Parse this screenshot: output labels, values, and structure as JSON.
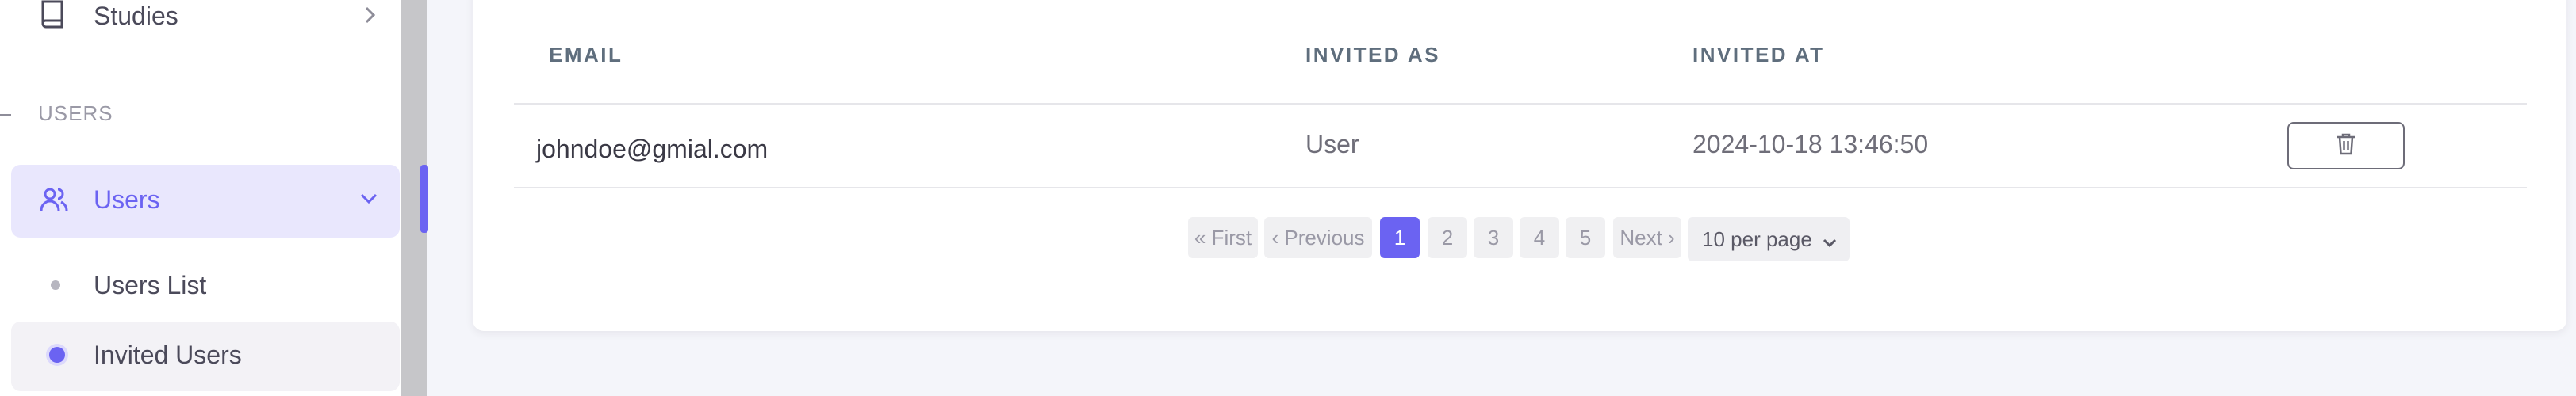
{
  "sidebar": {
    "studies_label": "Studies",
    "section_label": "USERS",
    "users_label": "Users",
    "sub_items": [
      {
        "label": "Users List",
        "active": false
      },
      {
        "label": "Invited Users",
        "active": true
      }
    ]
  },
  "table": {
    "headers": [
      "EMAIL",
      "INVITED AS",
      "INVITED AT"
    ],
    "rows": [
      {
        "email": "johndoe@gmial.com",
        "invited_as": "User",
        "invited_at": "2024-10-18 13:46:50"
      }
    ],
    "delete_icon": "trash-icon"
  },
  "pagination": {
    "first": "« First",
    "previous": "‹ Previous",
    "pages": [
      "1",
      "2",
      "3",
      "4",
      "5"
    ],
    "current_page": "1",
    "next": "Next ›",
    "per_page": "10 per page"
  },
  "colors": {
    "accent": "#6b63f2",
    "active_bg": "#e9e7fd",
    "page_bg": "#f4f5fa"
  }
}
